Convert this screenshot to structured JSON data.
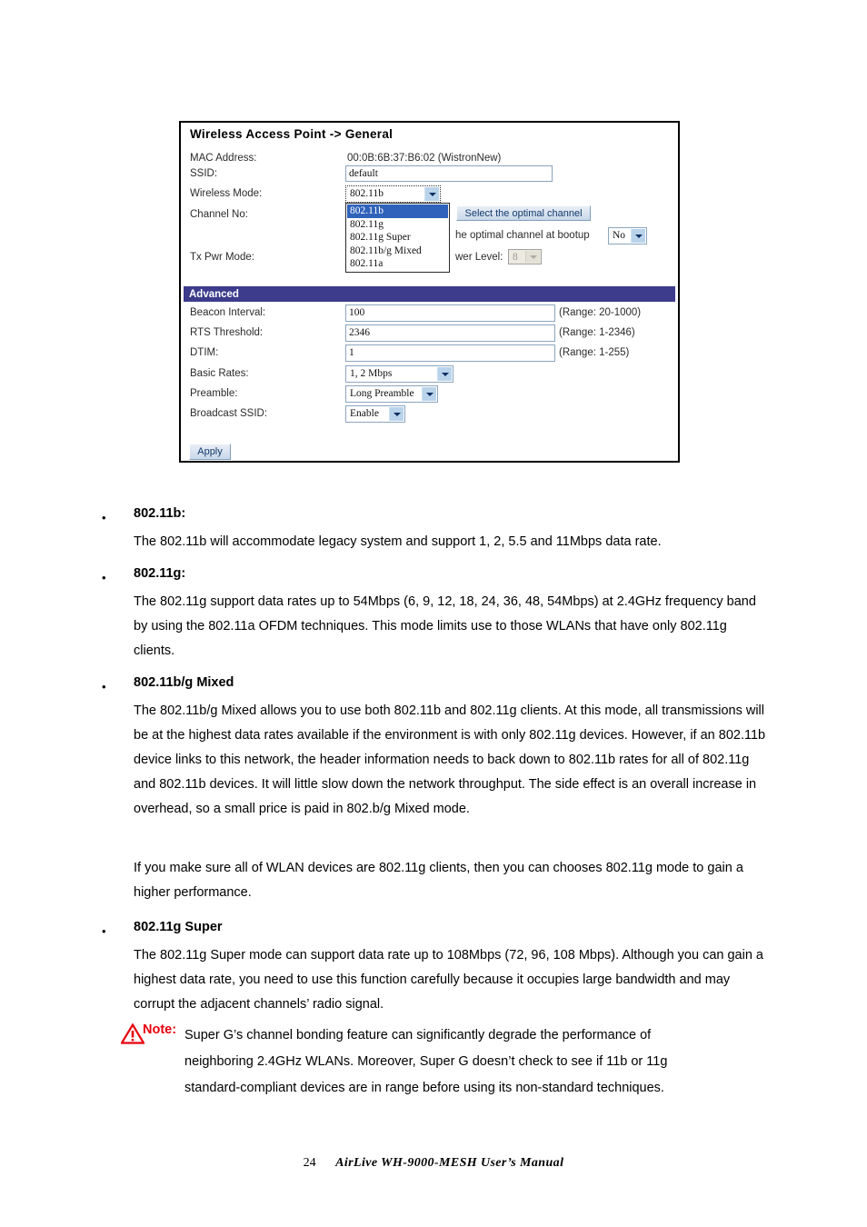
{
  "screenshot": {
    "title": "Wireless Access Point -> General",
    "fields": {
      "mac_label": "MAC Address:",
      "mac_value": "00:0B:6B:37:B6:02 (WistronNew)",
      "ssid_label": "SSID:",
      "ssid_value": "default",
      "wireless_mode_label": "Wireless Mode:",
      "wireless_mode_value": "802.11b",
      "channel_label": "Channel No:",
      "tx_pwr_label": "Tx Pwr Mode:",
      "select_optimal_button": "Select the optimal channel",
      "bootup_text": "he optimal channel at bootup",
      "bootup_value": "No",
      "power_level_label": "wer Level:",
      "power_level_value": "8"
    },
    "wireless_mode_options": [
      "802.11b",
      "802.11g",
      "802.11g Super",
      "802.11b/g Mixed",
      "802.11a"
    ],
    "advanced": {
      "header": "Advanced",
      "rows": [
        {
          "label": "Beacon Interval:",
          "value": "100",
          "range": "(Range: 20-1000)"
        },
        {
          "label": "RTS Threshold:",
          "value": "2346",
          "range": "(Range: 1-2346)"
        },
        {
          "label": "DTIM:",
          "value": "1",
          "range": "(Range: 1-255)"
        }
      ],
      "selects": [
        {
          "label": "Basic Rates:",
          "value": "1, 2 Mbps"
        },
        {
          "label": "Preamble:",
          "value": "Long Preamble"
        },
        {
          "label": "Broadcast SSID:",
          "value": "Enable"
        }
      ],
      "apply_button": "Apply"
    },
    "colors": {
      "advanced_bar": "#3c3b8c",
      "dropdown_selected": "#2f62ba",
      "input_border": "#8ba5bf"
    }
  },
  "document": {
    "sections": [
      {
        "heading": "802.11b:",
        "paragraphs": [
          "The 802.11b will accommodate legacy system and support 1, 2, 5.5 and 11Mbps data rate."
        ]
      },
      {
        "heading": "802.11g:",
        "paragraphs": [
          "The 802.11g support data rates up to 54Mbps (6, 9, 12, 18, 24, 36, 48, 54Mbps) at 2.4GHz frequency band by using the 802.11a OFDM techniques.   This mode limits use to those WLANs that have only 802.11g clients."
        ]
      },
      {
        "heading": "802.11b/g Mixed",
        "paragraphs": [
          "The 802.11b/g Mixed allows you to use both 802.11b and 802.11g clients. At this mode, all transmissions will be at the highest data rates available if the environment is with only 802.11g devices. However, if an 802.11b device links to this network, the header information needs to back down to 802.11b rates for all of 802.11g and 802.11b devices. It will little slow down the network throughput. The side effect is an overall increase in overhead, so a small price is paid in 802.b/g Mixed mode.",
          "If you make sure all of WLAN devices are 802.11g clients, then you can chooses 802.11g mode to gain a higher performance."
        ]
      },
      {
        "heading": "802.11g Super",
        "paragraphs": [
          "The 802.11g Super mode can support data rate up to 108Mbps (72, 96, 108 Mbps). Although you can gain a highest data rate, you need to use this function carefully because it occupies large bandwidth and may corrupt the adjacent channels’ radio signal."
        ]
      }
    ],
    "note": {
      "label": "Note:",
      "line1": "Super G’s channel bonding feature can significantly degrade the performance of",
      "line2": "neighboring 2.4GHz WLANs. Moreover, Super G doesn’t check to see if 11b or 11g",
      "line3": "standard-compliant devices are in range before using its non-standard techniques.",
      "color": "#e8000d"
    },
    "bullet_glyph": "•",
    "footer": {
      "page_number": "24",
      "manual_title": "AirLive  WH-9000-MESH  User’s  Manual"
    }
  }
}
